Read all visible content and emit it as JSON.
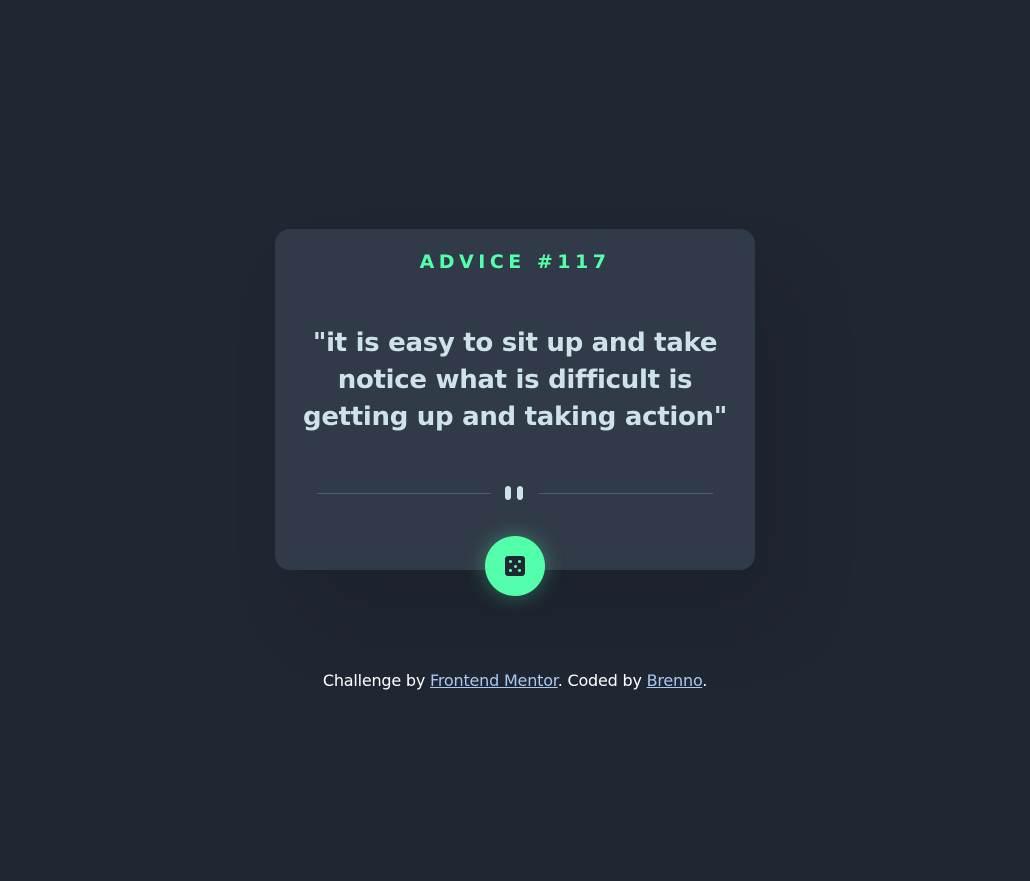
{
  "card": {
    "advice_id": "ADVICE #117",
    "quote": "\"it is easy to sit up and take notice what is difficult is getting up and taking action\""
  },
  "controls": {
    "dice_icon": "dice-icon",
    "divider_icon": "pause-icon"
  },
  "footer": {
    "challenge_prefix": "Challenge by ",
    "frontend_mentor_link": "Frontend Mentor",
    "coded_by_prefix": ". Coded by ",
    "author_link": "Brenno",
    "suffix": "."
  },
  "colors": {
    "background": "#202632",
    "card": "#313a48",
    "accent": "#53ffaa",
    "quote_text": "#cee3e9",
    "link": "#a8c9f0"
  }
}
